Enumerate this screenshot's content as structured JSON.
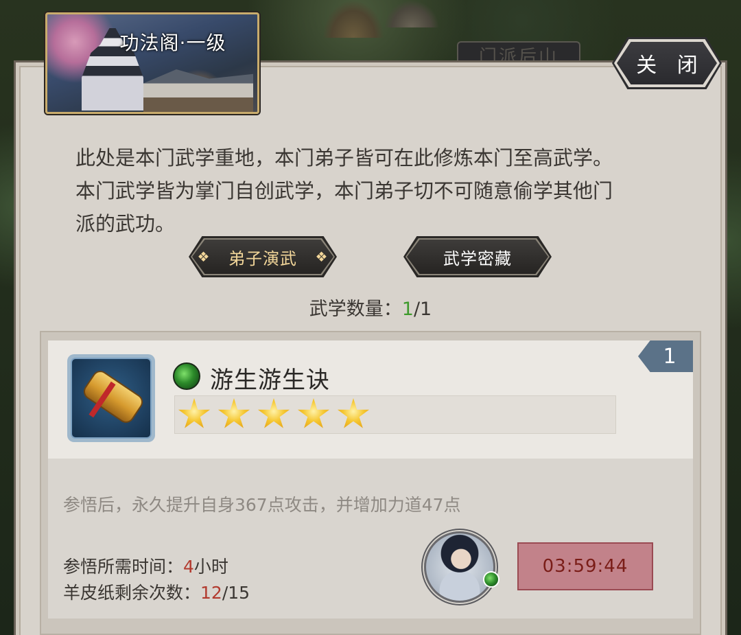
{
  "background_tab": "门派后山",
  "header": {
    "title": "功法阁·一级"
  },
  "close_button": "关 闭",
  "description": [
    "此处是本门武学重地，本门弟子皆可在此修炼本门至高武学。",
    "本门武学皆为掌门自创武学，本门弟子切不可随意偷学其他门",
    "派的武功。"
  ],
  "tabs": [
    {
      "label": "弟子演武",
      "active": true
    },
    {
      "label": "武学密藏",
      "active": false
    }
  ],
  "count": {
    "label": "武学数量：",
    "current": "1",
    "total": "/1"
  },
  "skill": {
    "rank": "1",
    "name": "游生游生诀",
    "stars": 5,
    "effect": "参悟后，永久提升自身367点攻击，并增加力道47点",
    "time_label": "参悟所需时间：",
    "time_value": "4",
    "time_unit": "小时",
    "paper_label": "羊皮纸剩余次数：",
    "paper_current": "12",
    "paper_total": "/15",
    "timer": "03:59:44"
  },
  "colors": {
    "active_tab_text": "#f3d79a",
    "count_current": "#3e9a2c",
    "highlight_red": "#b23a2e",
    "timer_bg": "#c2828a",
    "rank_tag": "#5b7288"
  },
  "icons": [
    "scroll-icon",
    "green-gem-icon",
    "star-icon",
    "character-avatar"
  ]
}
